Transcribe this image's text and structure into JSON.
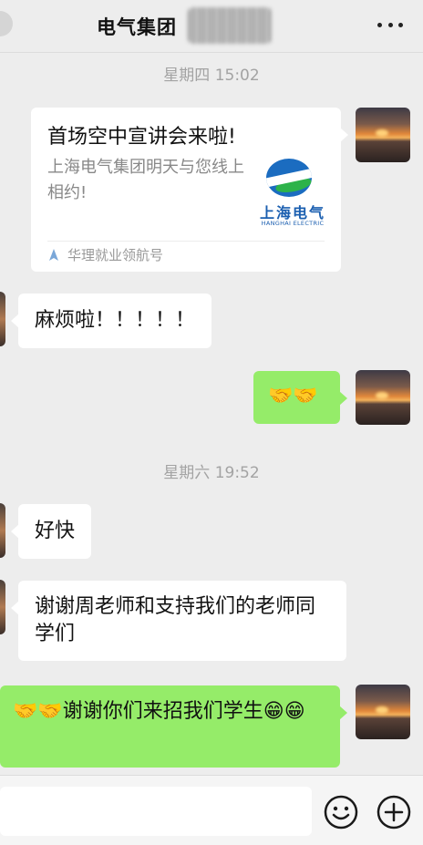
{
  "header": {
    "title": "电气集团"
  },
  "timestamps": [
    "星期四 15:02",
    "星期六 19:52"
  ],
  "card": {
    "title": "首场空中宣讲会来啦!",
    "description": "上海电气集团明天与您线上相约!",
    "logo_cn": "上海电气",
    "logo_en": "HANGHAI ELECTRIC",
    "source": "华理就业领航号"
  },
  "messages": [
    {
      "side": "left",
      "text": "麻烦啦！！！！！"
    },
    {
      "side": "right",
      "text": "🤝🤝"
    },
    {
      "side": "left",
      "text": "好快"
    },
    {
      "side": "left",
      "text": "谢谢周老师和支持我们的老师同学们"
    },
    {
      "side": "right",
      "text": "🤝🤝谢谢你们来招我们学生😁😁"
    }
  ],
  "icons": {
    "more": "more-dots-icon",
    "emoji": "emoji-icon",
    "add": "add-icon"
  },
  "colors": {
    "background": "#ededed",
    "bubble_green": "#95ec69",
    "bubble_white": "#ffffff",
    "timestamp": "#a3a3a3"
  }
}
